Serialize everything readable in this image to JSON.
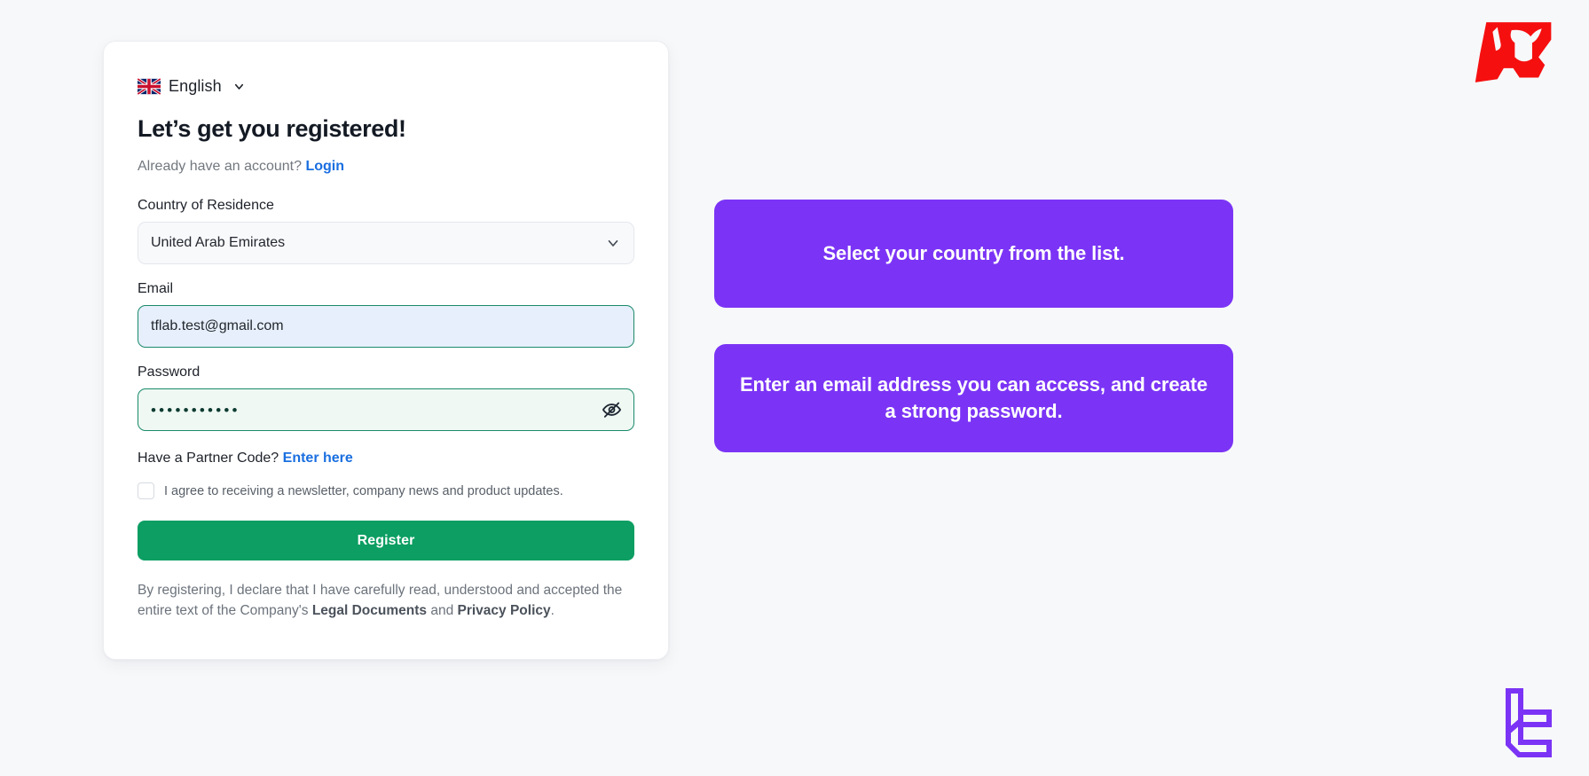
{
  "language": {
    "flag_icon": "uk-flag-icon",
    "label": "English",
    "chevron_icon": "chevron-down-icon"
  },
  "card": {
    "title": "Let’s get you registered!",
    "account_prompt": "Already have an account?",
    "login_link": "Login",
    "country": {
      "label": "Country of Residence",
      "value": "United Arab Emirates",
      "chevron_icon": "chevron-down-icon"
    },
    "email": {
      "label": "Email",
      "value": "tflab.test@gmail.com",
      "placeholder": "Email"
    },
    "password": {
      "label": "Password",
      "value": "•••••••••••",
      "placeholder": "Password",
      "toggle_icon": "eye-off-icon"
    },
    "partner": {
      "prompt": "Have a Partner Code?",
      "link": "Enter here"
    },
    "newsletter": {
      "checked": false,
      "label": "I agree to receiving a newsletter, company news and product updates."
    },
    "register_label": "Register",
    "legal": {
      "part1": "By registering, I declare that I have carefully read, understood and accepted the entire text of the Company's ",
      "bold1": "Legal Documents",
      "part2": " and ",
      "bold2": "Privacy Policy",
      "part3": "."
    }
  },
  "callouts": [
    {
      "text": "Select your country from the list."
    },
    {
      "text": "Enter an email address you can access, and create a strong password."
    }
  ],
  "logos": {
    "brand_icon": "bull-head-logo-icon",
    "brand_color": "#f60f0f",
    "watermark_icon": "lc-monogram-logo-icon",
    "watermark_color": "#7b34f5"
  },
  "colors": {
    "page_background": "#f7f8fa",
    "accent_purple": "#7b34f5",
    "register_green": "#0c9e62",
    "field_active_border": "#1a8a6b",
    "link_blue": "#1a6fe0"
  }
}
